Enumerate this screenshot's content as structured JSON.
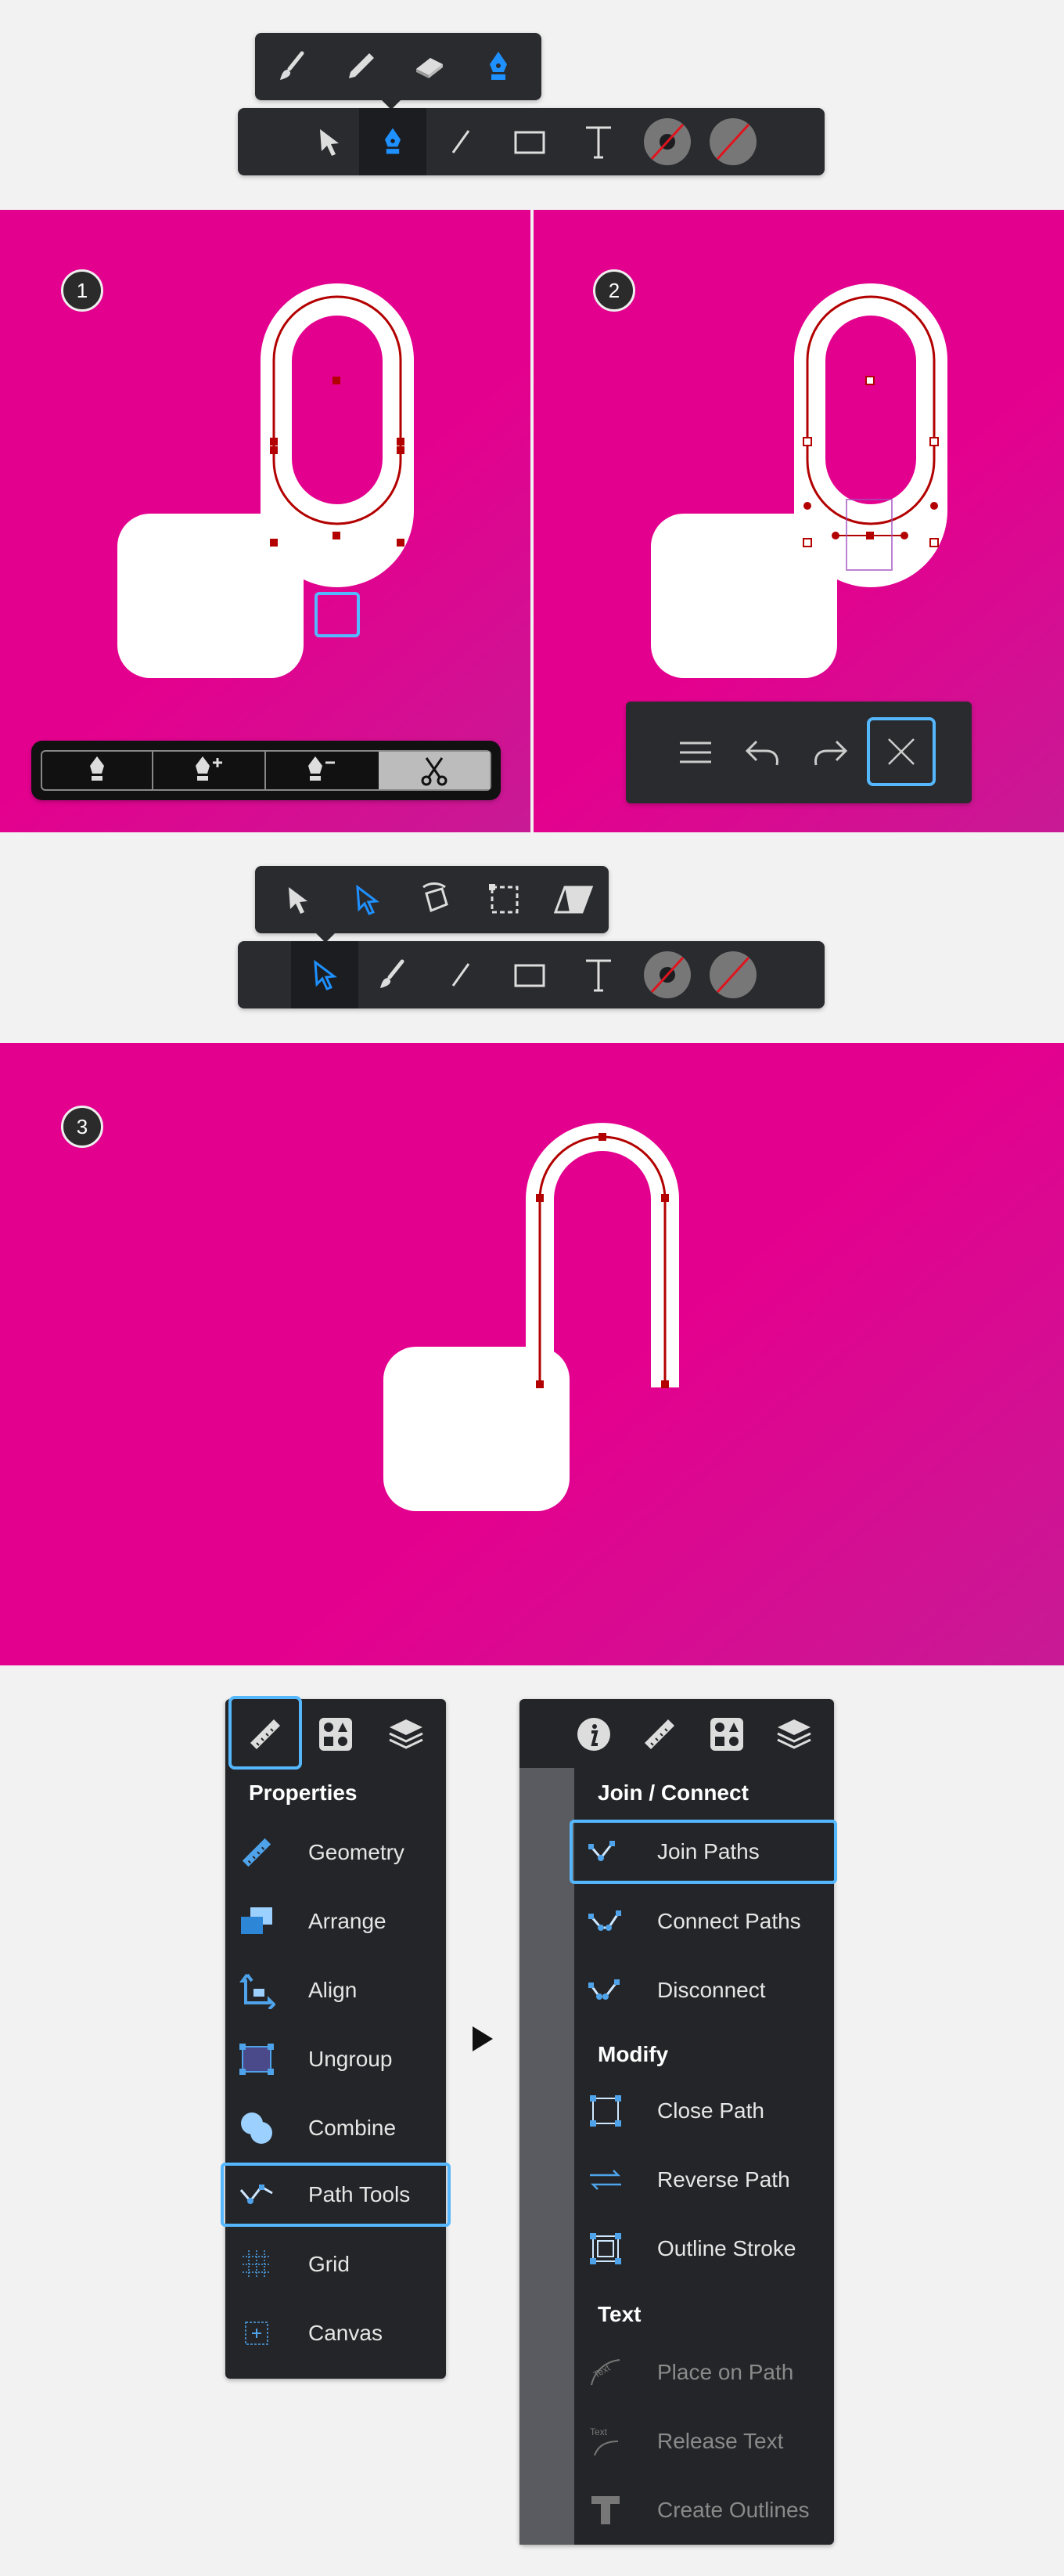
{
  "badges": {
    "one": "1",
    "two": "2",
    "three": "3"
  },
  "colors": {
    "accent": "#55b8ff",
    "panel": "#e4008e",
    "bar": "#2a2b2e",
    "path": "#b30000"
  },
  "toolbar1": {
    "popover": [
      "brush-icon",
      "pencil-icon",
      "eraser-icon",
      "pen-icon"
    ],
    "tools": [
      "move-icon",
      "pen-icon",
      "line-icon",
      "rectangle-icon",
      "text-icon",
      "stroke-icon",
      "fill-icon"
    ],
    "active": "pen-icon"
  },
  "penbar": {
    "tools": [
      "pen-icon",
      "add-anchor-icon",
      "delete-anchor-icon",
      "scissors-icon"
    ],
    "active": "scissors-icon"
  },
  "editbar": {
    "tools": [
      "menu-icon",
      "undo-icon",
      "redo-icon",
      "close-icon"
    ],
    "active": "close-icon"
  },
  "toolbar2": {
    "popover": [
      "move-icon",
      "node-icon",
      "rotate-icon",
      "transform-icon",
      "skew-icon"
    ],
    "tools": [
      "node-icon",
      "brush-icon",
      "line-icon",
      "rectangle-icon",
      "text-icon",
      "stroke-icon",
      "fill-icon"
    ],
    "active": "node-icon"
  },
  "properties_menu": {
    "title": "Properties",
    "items": [
      {
        "label": "Geometry",
        "icon": "ruler-icon"
      },
      {
        "label": "Arrange",
        "icon": "arrange-icon"
      },
      {
        "label": "Align",
        "icon": "align-icon"
      },
      {
        "label": "Ungroup",
        "icon": "ungroup-icon"
      },
      {
        "label": "Combine",
        "icon": "combine-icon"
      },
      {
        "label": "Path Tools",
        "icon": "path-tools-icon"
      },
      {
        "label": "Grid",
        "icon": "grid-icon"
      },
      {
        "label": "Canvas",
        "icon": "canvas-icon"
      }
    ],
    "selected": "Path Tools"
  },
  "path_menu": {
    "sections": [
      {
        "title": "Join / Connect",
        "items": [
          {
            "label": "Join Paths",
            "enabled": true
          },
          {
            "label": "Connect Paths",
            "enabled": true
          },
          {
            "label": "Disconnect",
            "enabled": true
          }
        ]
      },
      {
        "title": "Modify",
        "items": [
          {
            "label": "Close Path",
            "enabled": true
          },
          {
            "label": "Reverse Path",
            "enabled": true
          },
          {
            "label": "Outline Stroke",
            "enabled": true
          }
        ]
      },
      {
        "title": "Text",
        "items": [
          {
            "label": "Place on Path",
            "enabled": false
          },
          {
            "label": "Release Text",
            "enabled": false
          },
          {
            "label": "Create Outlines",
            "enabled": false
          }
        ]
      }
    ],
    "selected": "Join Paths"
  }
}
